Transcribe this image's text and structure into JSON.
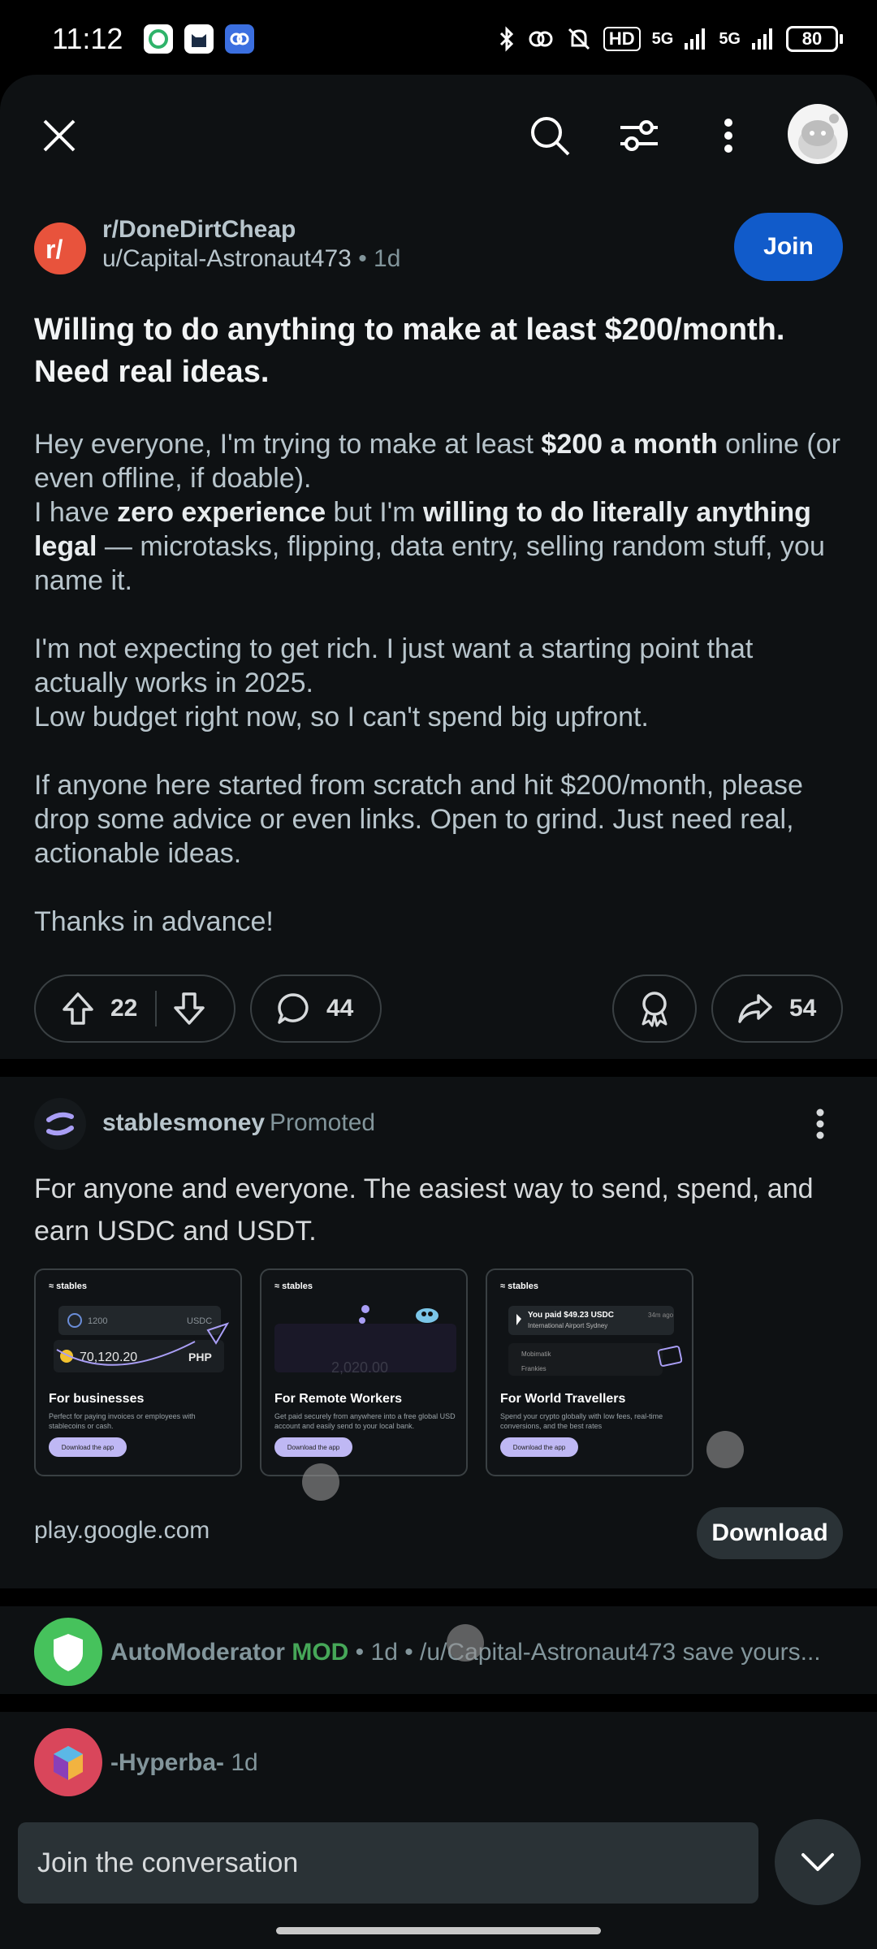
{
  "status": {
    "time": "11:12",
    "hd": "HD",
    "sig1": "5G",
    "sig2": "5G",
    "battery": "80"
  },
  "topbar": {
    "close": "close-icon",
    "search": "search-icon",
    "filter": "filter-icon",
    "more": "more-icon"
  },
  "post": {
    "subreddit": "r/DoneDirtCheap",
    "author": "u/Capital-Astronaut473",
    "age": "• 1d",
    "join_label": "Join",
    "title": "Willing to do anything to make at least $200/month. Need real ideas.",
    "body": {
      "p1_a": "Hey everyone, I'm trying to make at least ",
      "p1_b": "$200 a month",
      "p1_c": " online (or even offline, if doable).",
      "p1_d": "I have ",
      "p1_e": "zero experience",
      "p1_f": " but I'm ",
      "p1_g": "willing to do literally anything legal",
      "p1_h": " — microtasks, flipping, data entry, selling random stuff, you name it.",
      "p2_a": "I'm not expecting to get rich. I just want a starting point that actually works in 2025.",
      "p2_b": "Low budget right now, so I can't spend big upfront.",
      "p3": "If anyone here started from scratch and hit $200/month, please drop some advice or even links. Open to grind. Just need real, actionable ideas.",
      "p4": "Thanks in advance!"
    },
    "upvotes": "22",
    "comments": "44",
    "shares": "54"
  },
  "promo": {
    "advertiser": "stablesmoney",
    "tag": "Promoted",
    "text": "For anyone and everyone. The easiest way to send, spend, and earn USDC and USDT.",
    "cards": [
      {
        "brand": "≈ stables",
        "title": "For businesses",
        "desc": "Perfect for paying invoices or employees with stablecoins or cash.",
        "btn": "Download the app",
        "a1": "1200",
        "a2": "USDC",
        "a3": "70,120.20",
        "a4": "PHP"
      },
      {
        "brand": "≈ stables",
        "title": "For Remote Workers",
        "desc": "Get paid securely from anywhere into a free global USD account and easily send to your local bank.",
        "btn": "Download the app",
        "a1": "2,020.00"
      },
      {
        "brand": "≈ stables",
        "title": "For World Travellers",
        "desc": "Spend your crypto globally with low fees, real-time conversions, and the best rates",
        "btn": "Download the app",
        "a1": "You paid $49.23 USDC",
        "a2": "International Airport Sydney",
        "a3": "34m ago",
        "a4": "Mobimatik",
        "a5": "Frankies"
      }
    ],
    "url": "play.google.com",
    "download_label": "Download"
  },
  "comments": [
    {
      "name": "AutoModerator",
      "mod": "MOD",
      "meta": "• 1d • /u/Capital-Astronaut473 save yours..."
    },
    {
      "name": "-Hyperba-",
      "meta": "1d"
    }
  ],
  "composer": {
    "placeholder": "Join the conversation"
  }
}
